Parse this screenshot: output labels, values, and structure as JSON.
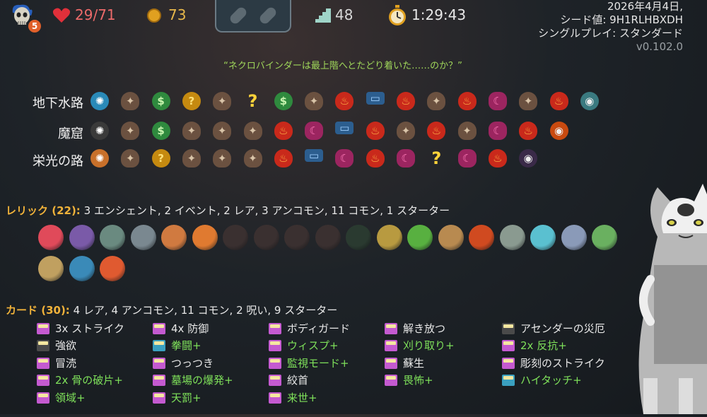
{
  "hud": {
    "ascension": "5",
    "hp": "29/71",
    "gold": "73",
    "floor": "48",
    "time": "1:29:43"
  },
  "info": {
    "date": "2026年4月4日,",
    "seed": "シード値: 9H1RLHBXDH",
    "mode": "シングルプレイ: スタンダード",
    "version": "v0.102.0"
  },
  "quote": "“ネクロバインダーは最上階へとたどり着いた……のか？”",
  "acts": [
    {
      "name": "地下水路",
      "nodes": [
        "ancient",
        "monster",
        "merchant",
        "event",
        "monster",
        "unknown",
        "merchant",
        "monster",
        "elite",
        "treasure",
        "elite",
        "monster",
        "elite",
        "rest",
        "monster",
        "elite",
        "boss"
      ]
    },
    {
      "name": "魔窟",
      "nodes": [
        "ancient",
        "monster",
        "merchant",
        "monster",
        "monster",
        "monster",
        "elite",
        "rest",
        "treasure",
        "elite",
        "monster",
        "elite",
        "monster",
        "rest",
        "elite",
        "boss"
      ]
    },
    {
      "name": "栄光の路",
      "nodes": [
        "ancient",
        "monster",
        "event",
        "monster",
        "monster",
        "monster",
        "elite",
        "treasure",
        "rest",
        "elite",
        "rest",
        "unknown",
        "rest",
        "elite",
        "boss"
      ]
    }
  ],
  "relics": {
    "heading": "レリック (22):",
    "summary": "3 エンシェント, 2 イベント, 2 レア, 3 アンコモン, 11 コモン, 1 スターター",
    "items": [
      "heart-relic",
      "orb-relic",
      "teapot-relic",
      "newtons-cradle-relic",
      "wooden-plank-relic",
      "fruit-basket-relic",
      "cloth-relic",
      "boot-relic",
      "hat-relic",
      "pot-relic",
      "lantern-relic",
      "horn-relic",
      "green-gem-relic",
      "backpack-relic",
      "mace-relic",
      "candelabra-relic",
      "prism-relic",
      "shield-relic",
      "serpent-relic",
      "flower-pot-relic",
      "anchor-relic",
      "flame-flower-relic"
    ]
  },
  "cards": {
    "heading": "カード (30):",
    "summary": "4 レア, 4 アンコモン, 11 コモン, 2 呪い, 9 スターター",
    "columns": [
      [
        {
          "label": "3x ストライク",
          "up": false,
          "color": "#c45ad0"
        },
        {
          "label": "強欲",
          "up": false,
          "color": "#4a4a4a"
        },
        {
          "label": "冒涜",
          "up": false,
          "color": "#c45ad0"
        },
        {
          "label": "2x 骨の破片+",
          "up": true,
          "color": "#c45ad0"
        },
        {
          "label": "領域+",
          "up": true,
          "color": "#c45ad0"
        }
      ],
      [
        {
          "label": "4x 防御",
          "up": false,
          "color": "#c45ad0"
        },
        {
          "label": "拳闘+",
          "up": true,
          "color": "#3aa0c0"
        },
        {
          "label": "つっつき",
          "up": false,
          "color": "#c45ad0"
        },
        {
          "label": "墓場の爆発+",
          "up": true,
          "color": "#c45ad0"
        },
        {
          "label": "天罰+",
          "up": true,
          "color": "#c45ad0"
        }
      ],
      [
        {
          "label": "ボディガード",
          "up": false,
          "color": "#c45ad0"
        },
        {
          "label": "ウィスプ+",
          "up": true,
          "color": "#c45ad0"
        },
        {
          "label": "監視モード+",
          "up": true,
          "color": "#c45ad0"
        },
        {
          "label": "絞首",
          "up": false,
          "color": "#c45ad0"
        },
        {
          "label": "来世+",
          "up": true,
          "color": "#c45ad0"
        }
      ],
      [
        {
          "label": "解き放つ",
          "up": false,
          "color": "#c45ad0"
        },
        {
          "label": "刈り取り+",
          "up": true,
          "color": "#c45ad0"
        },
        {
          "label": "蘇生",
          "up": false,
          "color": "#c45ad0"
        },
        {
          "label": "畏怖+",
          "up": true,
          "color": "#c45ad0"
        }
      ],
      [
        {
          "label": "アセンダーの災厄",
          "up": false,
          "color": "#4a4a4a"
        },
        {
          "label": "2x 反抗+",
          "up": true,
          "color": "#c45ad0"
        },
        {
          "label": "彫刻のストライク",
          "up": false,
          "color": "#c45ad0"
        },
        {
          "label": "ハイタッチ+",
          "up": true,
          "color": "#3aa0c0"
        }
      ]
    ]
  },
  "colors": {
    "accent": "#f0b23a",
    "upgraded": "#7ee05a",
    "quote": "#9fd65a"
  }
}
